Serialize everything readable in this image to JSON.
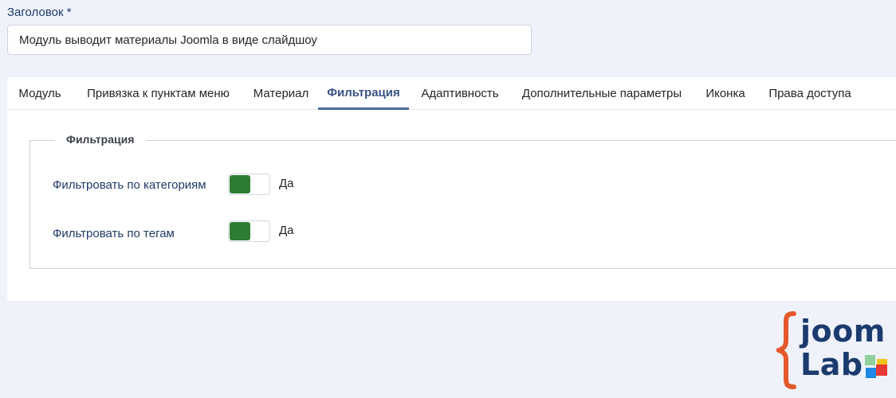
{
  "title_field": {
    "label": "Заголовок *",
    "value": "Модуль выводит материалы Joomla в виде слайдшоу"
  },
  "tabs": [
    {
      "label": "Модуль",
      "active": false
    },
    {
      "label": "Привязка к пунктам меню",
      "active": false
    },
    {
      "label": "Материал",
      "active": false
    },
    {
      "label": "Фильтрация",
      "active": true
    },
    {
      "label": "Адаптивность",
      "active": false
    },
    {
      "label": "Дополнительные параметры",
      "active": false
    },
    {
      "label": "Иконка",
      "active": false
    },
    {
      "label": "Права доступа",
      "active": false
    }
  ],
  "filtration": {
    "legend": "Фильтрация",
    "rows": [
      {
        "label": "Фильтровать по категориям",
        "state": "Да",
        "on": true
      },
      {
        "label": "Фильтровать по тегам",
        "state": "Да",
        "on": true
      }
    ]
  },
  "logo": {
    "line1": "joom",
    "line2": "Lab"
  },
  "colors": {
    "background": "#eff2fa",
    "active_tab": "#3a5487",
    "switch_on": "#2e7d32",
    "logo_blue": "#1b3b6e",
    "logo_orange": "#e4582a"
  }
}
